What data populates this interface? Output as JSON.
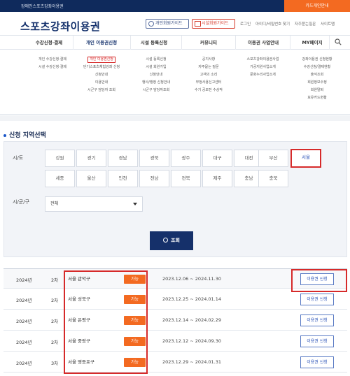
{
  "topbar": {
    "label": "장애인스포츠강좌이용권",
    "card_guide": "카드개인안내"
  },
  "header": {
    "logo": "스포츠강좌이용권",
    "member_btn": "개인회원가이드",
    "facility_btn": "시설회원가이드",
    "utils": [
      "로그인",
      "아이디/비밀번호 찾기",
      "자주묻는질문",
      "사이트맵"
    ]
  },
  "nav": [
    "수강신청·결제",
    "개인 이용권신청",
    "시설 등록신청",
    "커뮤니티",
    "이용권 사업안내",
    "MY페이지"
  ],
  "mega": [
    [
      "개인 수강신청·결제",
      "시설 수강신청·결제"
    ],
    [
      "개인 이용권신청",
      "단기스포츠체험강좌 신청",
      "신청안내",
      "이용안내",
      "시군구 담당자 조회"
    ],
    [
      "시설 등록신청",
      "시설 회원가입",
      "신청안내",
      "행사/행정 신청안내",
      "시군구 담당자조회"
    ],
    [
      "공지사항",
      "자주묻는 질문",
      "고객의 소리",
      "부정사용신고센터",
      "수기 공모전 수상작"
    ],
    [
      "스포츠강좌이용권사업",
      "가공지원사업소개",
      "문화누리사업소개"
    ],
    [
      "강좌이용권 신청현황",
      "수강신청/결제현황",
      "출석조회",
      "회원정보수정",
      "회원탈퇴",
      "보유카드현황"
    ]
  ],
  "region": {
    "title": "신청 지역선택",
    "sido_label": "시/도",
    "sigungu_label": "시/군/구",
    "sido_row1": [
      "강원",
      "경기",
      "경남",
      "경북",
      "광주",
      "대구",
      "대전",
      "부산",
      "서울"
    ],
    "sido_row2": [
      "세종",
      "울산",
      "인천",
      "전남",
      "전북",
      "제주",
      "충남",
      "충북"
    ],
    "selected": "서울",
    "sigungu_value": "전체",
    "search_btn": "조회"
  },
  "results": [
    {
      "year": "2024년",
      "round": "2차",
      "area": "서울 관악구",
      "status": "가능",
      "period": "2023.12.06 ~ 2024.11.30",
      "apply": "이용권 신청"
    },
    {
      "year": "2024년",
      "round": "2차",
      "area": "서울 성북구",
      "status": "가능",
      "period": "2023.12.25 ~ 2024.01.14",
      "apply": "이용권 신청"
    },
    {
      "year": "2024년",
      "round": "2차",
      "area": "서울 은평구",
      "status": "가능",
      "period": "2023.12.14 ~ 2024.02.29",
      "apply": "이용권 신청"
    },
    {
      "year": "2024년",
      "round": "2차",
      "area": "서울 중랑구",
      "status": "가능",
      "period": "2023.12.12 ~ 2024.09.30",
      "apply": "이용권 신청"
    },
    {
      "year": "2024년",
      "round": "3차",
      "area": "서울 영등포구",
      "status": "가능",
      "period": "2023.12.29 ~ 2024.01.31",
      "apply": "이용권 신청"
    }
  ],
  "colors": {
    "navy": "#13306b",
    "orange": "#f36a21",
    "highlight_red": "#d62a2a"
  }
}
